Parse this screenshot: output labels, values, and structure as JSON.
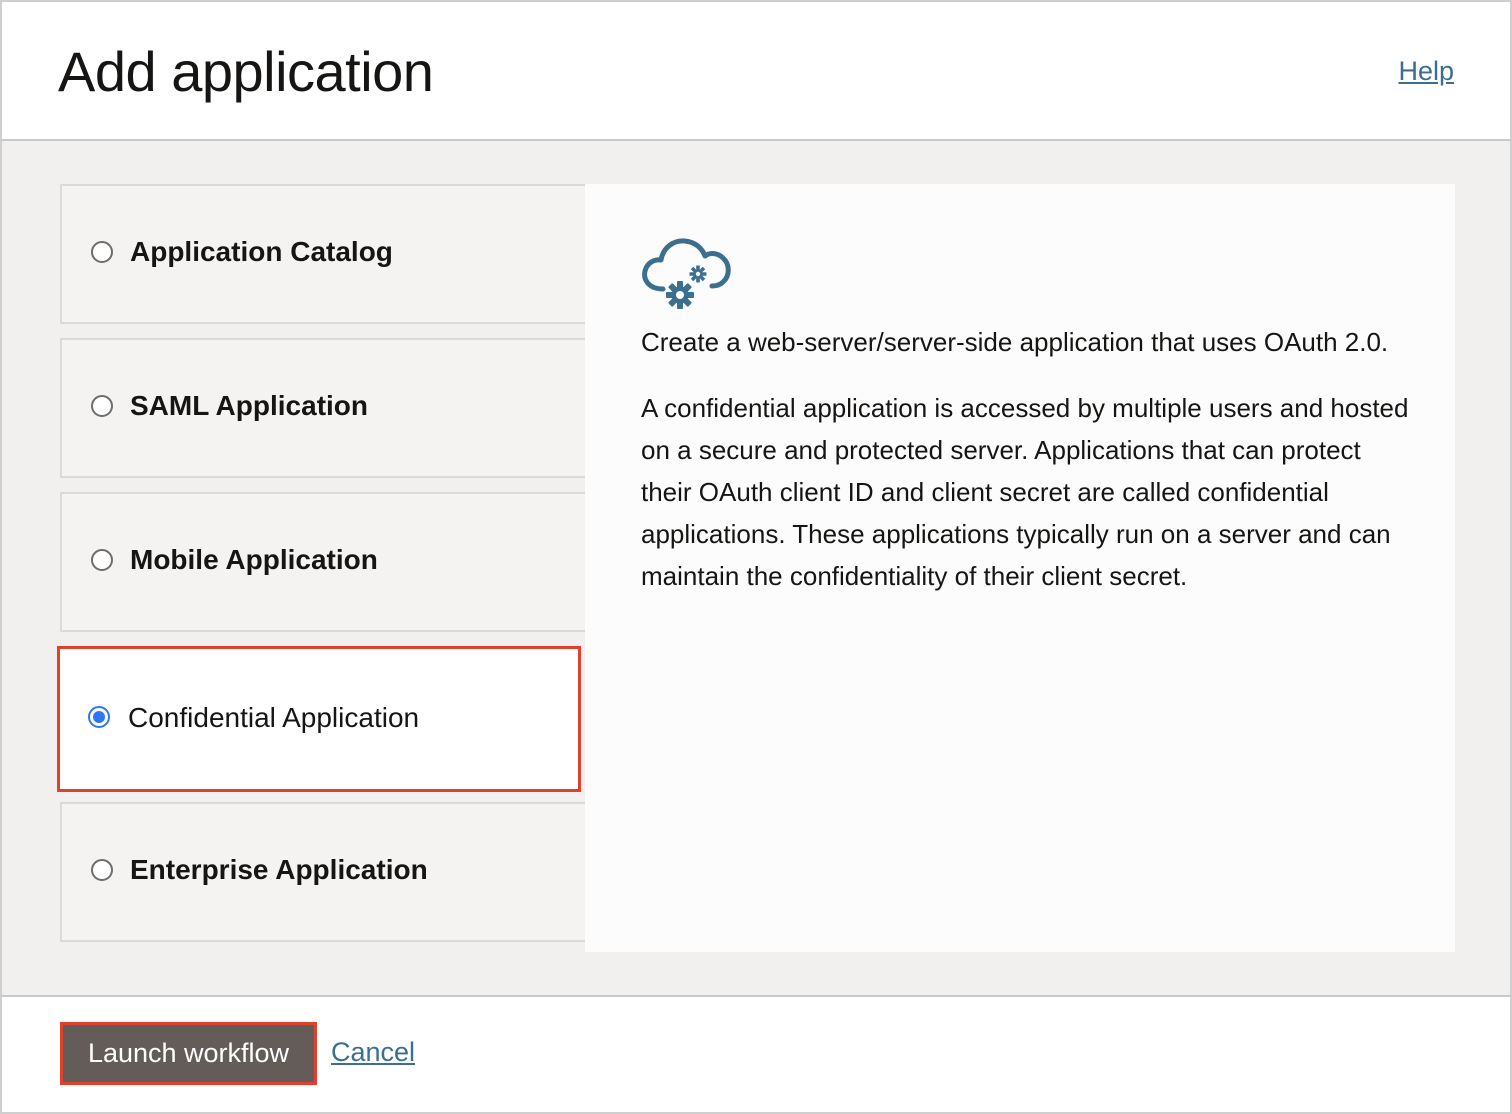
{
  "dialog": {
    "title": "Add application",
    "help_label": "Help"
  },
  "options": [
    {
      "label": "Application Catalog",
      "selected": false
    },
    {
      "label": "SAML Application",
      "selected": false
    },
    {
      "label": "Mobile Application",
      "selected": false
    },
    {
      "label": "Confidential Application",
      "selected": true
    },
    {
      "label": "Enterprise Application",
      "selected": false
    }
  ],
  "detail": {
    "icon": "cloud-gears-icon",
    "paragraphs": [
      "Create a web-server/server-side application that uses OAuth 2.0.",
      "A confidential application is accessed by multiple users and hosted on a secure and protected server. Applications that can protect their OAuth client ID and client secret are called confidential applications. These applications typically run on a server and can maintain the confidentiality of their client secret."
    ]
  },
  "footer": {
    "launch_label": "Launch workflow",
    "cancel_label": "Cancel"
  },
  "colors": {
    "accent_radio": "#2f76f6",
    "highlight_border": "#e0412d",
    "link": "#3b6f8f",
    "button_bg": "#645c58",
    "icon": "#3c6e8e"
  }
}
